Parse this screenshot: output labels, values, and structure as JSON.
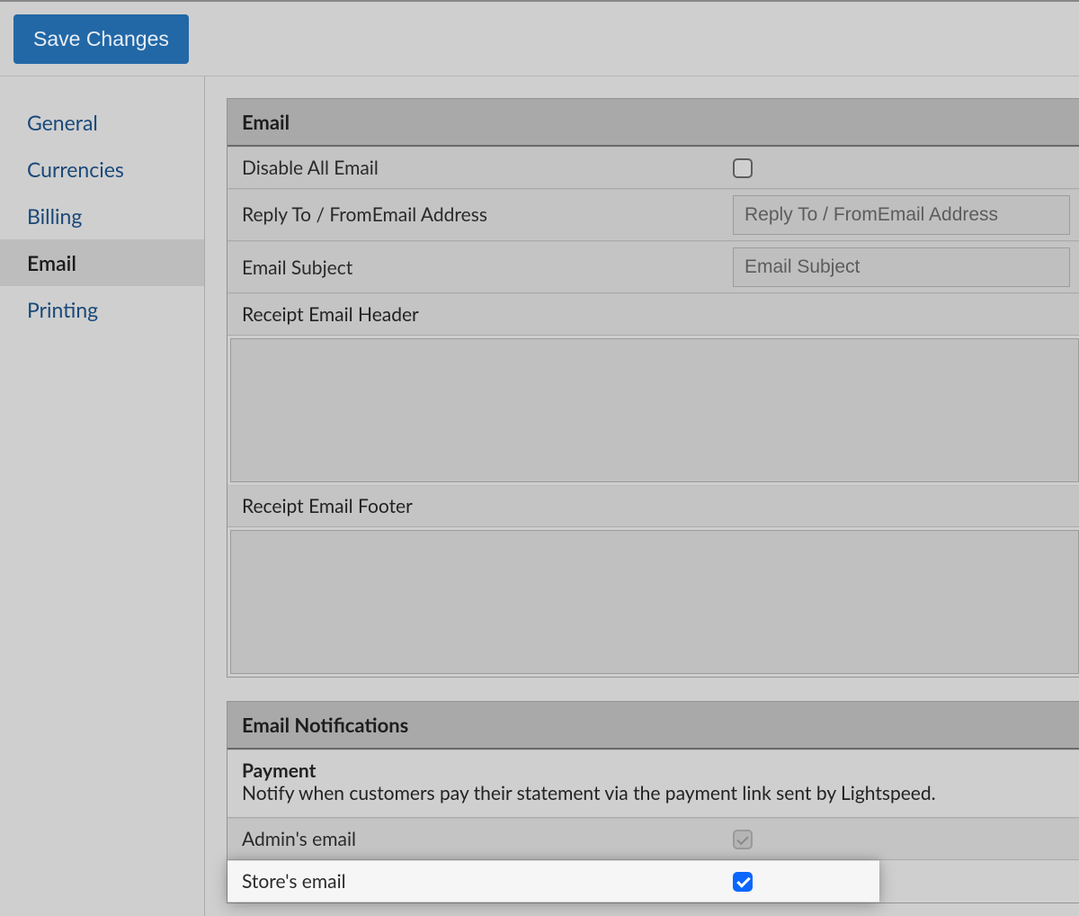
{
  "header": {
    "save_label": "Save Changes"
  },
  "sidebar": {
    "items": [
      {
        "label": "General"
      },
      {
        "label": "Currencies"
      },
      {
        "label": "Billing"
      },
      {
        "label": "Email"
      },
      {
        "label": "Printing"
      }
    ],
    "active_index": 3
  },
  "email_panel": {
    "title": "Email",
    "disable_all_label": "Disable All Email",
    "reply_to_label_line1": "Reply To / From",
    "reply_to_label_line2": "Email Address",
    "reply_to_placeholder": "Reply To / FromEmail Address",
    "subject_label": "Email Subject",
    "subject_placeholder": "Email Subject",
    "header_label": "Receipt Email Header",
    "footer_label": "Receipt Email Footer"
  },
  "notifications_panel": {
    "title": "Email Notifications",
    "section_heading": "Payment",
    "section_desc": "Notify when customers pay their statement via the payment link sent by Lightspeed.",
    "admin_label": "Admin's email",
    "store_label": "Store's email"
  }
}
